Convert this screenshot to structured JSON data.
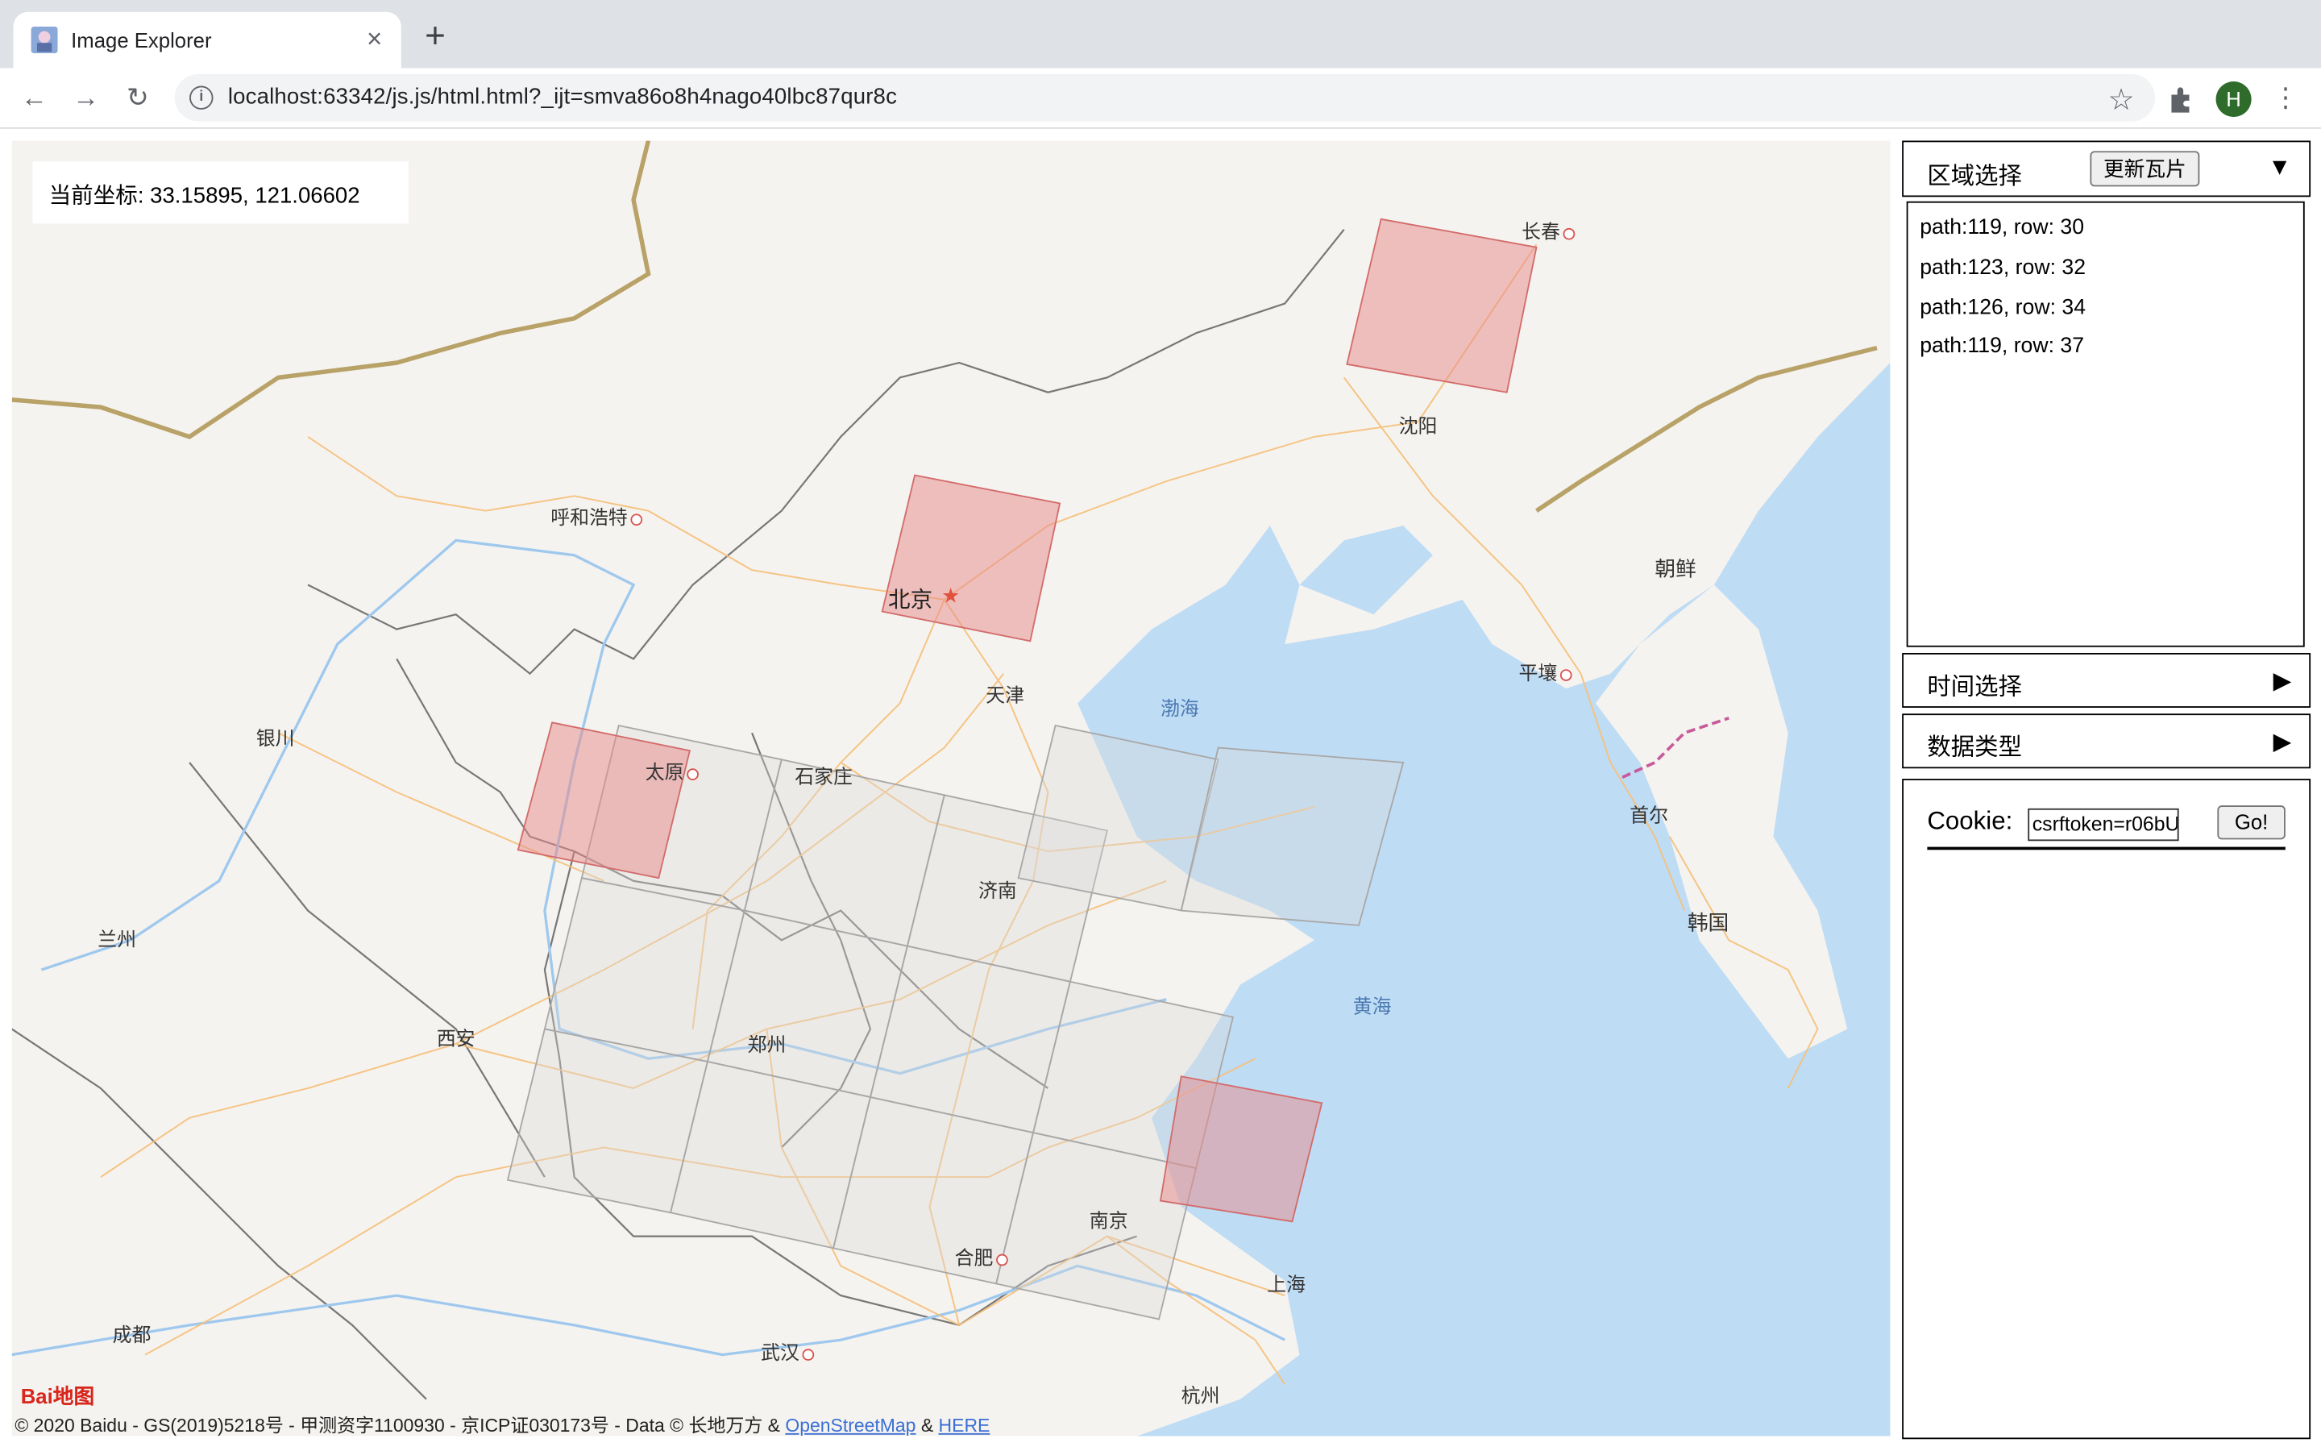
{
  "browser": {
    "tab_title": "Image Explorer",
    "url": "localhost:63342/js.js/html.html?_ijt=smva86o8h4nago40lbc87qur8c",
    "profile_initial": "H"
  },
  "map": {
    "coord_label": "当前坐标: 33.15895, 121.06602",
    "cities": [
      "长春",
      "沈阳",
      "呼和浩特",
      "北京",
      "天津",
      "银川",
      "太原",
      "石家庄",
      "济南",
      "兰州",
      "西安",
      "郑州",
      "南京",
      "合肥",
      "上海",
      "成都",
      "武汉",
      "杭州",
      "平壤",
      "首尔"
    ],
    "seas": [
      "渤海",
      "黄海"
    ],
    "countries": [
      "朝鲜",
      "韩国"
    ],
    "logo_text": "Bai地图",
    "copyright_prefix": "© 2020 Baidu - GS(2019)5218号 - 甲测资字1100930 - 京ICP证030173号 - Data © 长地万方 & ",
    "copyright_osm": "OpenStreetMap",
    "copyright_amp": " & ",
    "copyright_here": "HERE",
    "colors": {
      "tile_selected": "#e88a8a",
      "tile_grid": "#bdbdbd",
      "sea": "#bfdcf5",
      "road": "#f6c07a"
    }
  },
  "panel": {
    "region": {
      "title": "区域选择",
      "update_button": "更新瓦片",
      "arrow": "▼"
    },
    "paths": [
      "path:119, row: 30",
      "path:123, row: 32",
      "path:126, row: 34",
      "path:119, row: 37"
    ],
    "time": {
      "title": "时间选择",
      "arrow": "▶"
    },
    "datatype": {
      "title": "数据类型",
      "arrow": "▶"
    },
    "cookie": {
      "label": "Cookie:",
      "value": "csrftoken=r06bU",
      "go_button": "Go!"
    }
  }
}
